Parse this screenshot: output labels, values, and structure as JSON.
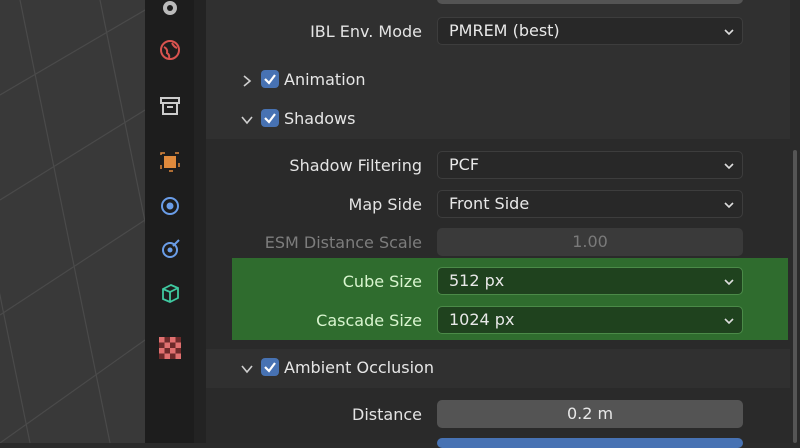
{
  "tabs": [
    {
      "icon": "render-icon"
    },
    {
      "icon": "world-icon"
    },
    {
      "icon": "collection-icon"
    },
    {
      "icon": "object-icon"
    },
    {
      "icon": "physics-icon"
    },
    {
      "icon": "constraints-icon"
    },
    {
      "icon": "object-data-icon"
    },
    {
      "icon": "texture-icon"
    }
  ],
  "colors": {
    "accent": "#4772b3",
    "highlight_green": "#2f6c2e",
    "panel": "#303030"
  },
  "properties": {
    "ibl_env_mode": {
      "label": "IBL Env. Mode",
      "value": "PMREM (best)"
    },
    "shadow_filtering": {
      "label": "Shadow Filtering",
      "value": "PCF"
    },
    "map_side": {
      "label": "Map Side",
      "value": "Front Side"
    },
    "esm_distance_scale": {
      "label": "ESM Distance Scale",
      "value": "1.00"
    },
    "cube_size": {
      "label": "Cube Size",
      "value": "512 px"
    },
    "cascade_size": {
      "label": "Cascade Size",
      "value": "1024 px"
    },
    "distance": {
      "label": "Distance",
      "value": "0.2 m"
    }
  },
  "sections": {
    "animation": {
      "title": "Animation",
      "expanded": false,
      "checked": true
    },
    "shadows": {
      "title": "Shadows",
      "expanded": true,
      "checked": true
    },
    "ambient_occlusion": {
      "title": "Ambient Occlusion",
      "expanded": true,
      "checked": true
    }
  }
}
